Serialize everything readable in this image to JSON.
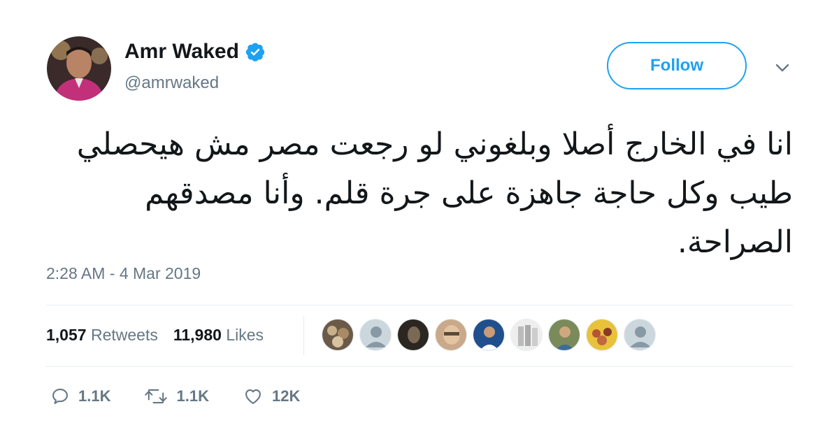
{
  "author": {
    "display_name": "Amr Waked",
    "handle": "@amrwaked",
    "verified": true
  },
  "follow_label": "Follow",
  "tweet": {
    "text": "انا في الخارج أصلا وبلغوني لو رجعت مصر مش هيحصلي طيب وكل حاجة جاهزة على جرة قلم. وأنا مصدقهم الصراحة.",
    "timestamp": "2:28 AM - 4 Mar 2019"
  },
  "stats": {
    "retweets_count": "1,057",
    "retweets_label": "Retweets",
    "likes_count": "11,980",
    "likes_label": "Likes"
  },
  "actions": {
    "reply_count": "1.1K",
    "retweet_count": "1.1K",
    "like_count": "12K"
  },
  "colors": {
    "accent": "#1da1f2",
    "muted_text": "#657786",
    "divider": "#e6ecf0"
  },
  "icons": [
    "verified-badge-icon",
    "chevron-down-icon",
    "reply-icon",
    "retweet-icon",
    "heart-icon"
  ]
}
